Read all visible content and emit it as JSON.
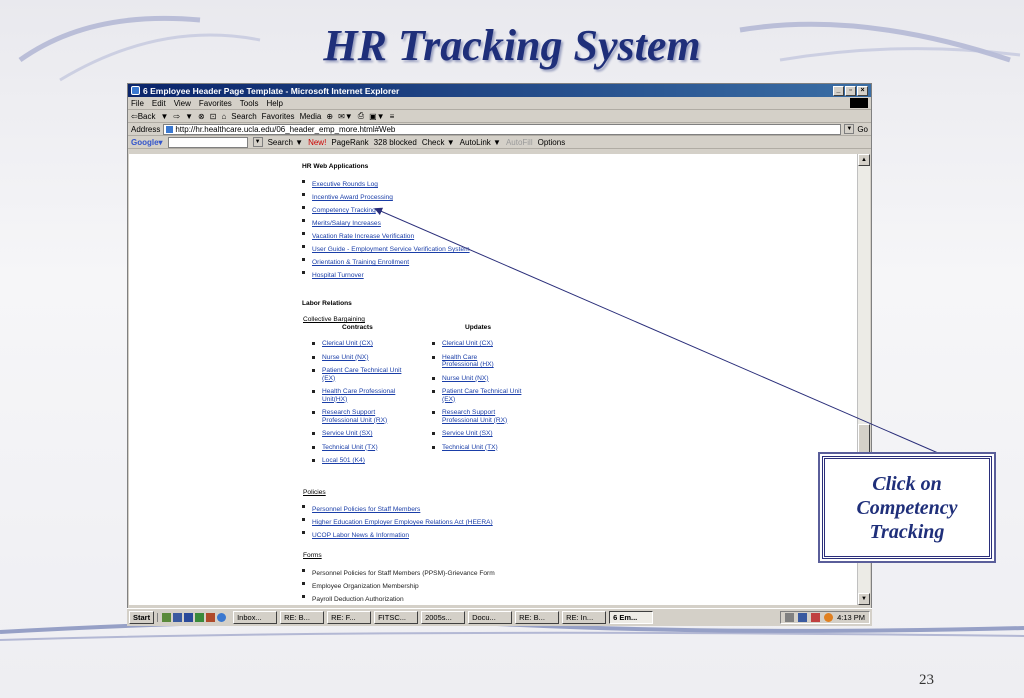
{
  "slide": {
    "title": "HR Tracking System",
    "number": "23"
  },
  "window": {
    "title": "6 Employee Header Page Template - Microsoft Internet Explorer",
    "buttons": [
      "_",
      "▫",
      "×"
    ],
    "menu": [
      "File",
      "Edit",
      "View",
      "Favorites",
      "Tools",
      "Help"
    ],
    "toolbar": [
      "⇦Back",
      "▼",
      "⇨",
      "▼",
      "⊗",
      "⊡",
      "⌂",
      "Search",
      "Favorites",
      "Media",
      "⊕",
      "✉▼",
      "⎙",
      "▣▼",
      "≡"
    ],
    "address_label": "Address",
    "address_value": "http://hr.healthcare.ucla.edu/06_header_emp_more.html#Web",
    "go_label": "Go",
    "google_bar": [
      "Search ▼",
      "New!",
      "PageRank",
      "328 blocked",
      "Check ▼",
      "AutoLink ▼",
      "AutoFill",
      "Options"
    ],
    "google_logo": "Google▾"
  },
  "content": {
    "web_apps_heading": "HR Web Applications",
    "web_apps": [
      "Executive Rounds Log",
      "Incentive Award Processing",
      "Competency Tracking",
      "Merits/Salary Increases",
      "Vacation Rate Increase Verification",
      "User Guide - Employment Service Verification System",
      "Orientation & Training Enrollment",
      "Hospital Turnover"
    ],
    "labor_heading": "Labor Relations",
    "collective_link": "Collective Bargaining",
    "contracts_heading": "Contracts",
    "updates_heading": "Updates",
    "contracts": [
      "Clerical Unit (CX)",
      "Nurse Unit (NX)",
      "Patient Care Technical Unit (EX)",
      "Health Care Professional Unit(HX)",
      "Research Support Professional Unit (RX)",
      "Service Unit (SX)",
      "Technical Unit (TX)",
      "Local 501 (K4)"
    ],
    "updates": [
      "Clerical Unit (CX)",
      "Health Care Professional (HX)",
      "Nurse Unit (NX)",
      "Patient Care Technical Unit (EX)",
      "Research Support Professional Unit (RX)",
      "Service Unit (SX)",
      "Technical Unit (TX)"
    ],
    "policies_heading": "Policies",
    "policies": [
      "Personnel Policies for Staff Members",
      "Higher Education Employer Employee Relations Act (HEERA)",
      "UCOP Labor News & Information"
    ],
    "forms_heading": "Forms",
    "forms": [
      "Personnel Policies for Staff Members (PPSM)-Grievance Form",
      "Employee Organization Membership",
      "Payroll Deduction Authorization"
    ]
  },
  "taskbar": {
    "start": "Start",
    "tasks": [
      "Inbox...",
      "RE: B...",
      "RE: F...",
      "FITSC...",
      "2005s...",
      "Docu...",
      "RE: B...",
      "RE: In...",
      "6 Em..."
    ],
    "clock": "4:13 PM"
  },
  "callout": {
    "lines": [
      "Click on",
      "Competency",
      "Tracking"
    ]
  },
  "colors": {
    "title": "#1f2f7a",
    "link": "#1a3ea8",
    "titlebar": "#0a246a"
  }
}
